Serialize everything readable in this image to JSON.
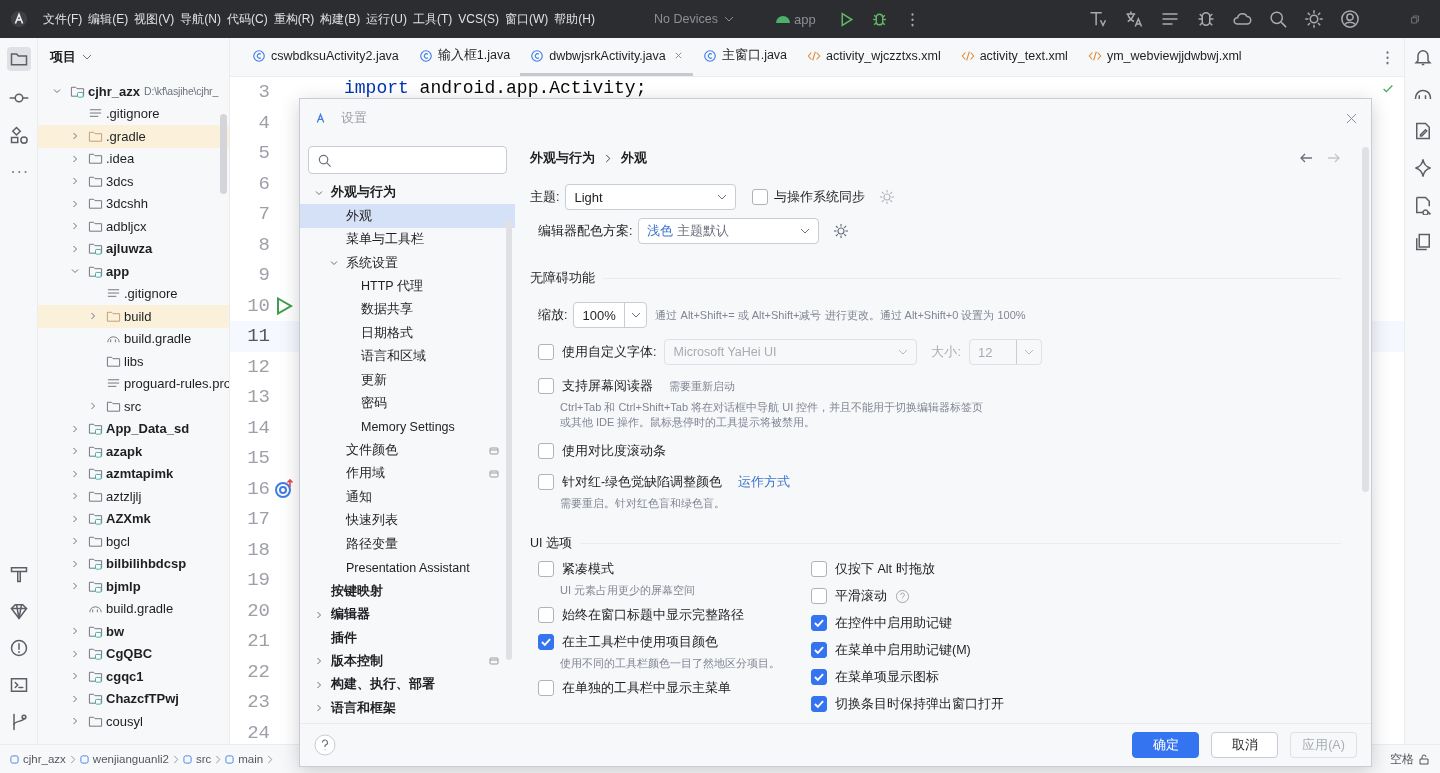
{
  "menu": [
    "文件(F)",
    "编辑(E)",
    "视图(V)",
    "导航(N)",
    "代码(C)",
    "重构(R)",
    "构建(B)",
    "运行(U)",
    "工具(T)",
    "VCS(S)",
    "窗口(W)",
    "帮助(H)"
  ],
  "device": "No Devices",
  "run_config": "app",
  "project_panel": {
    "title": "项目",
    "tree": [
      {
        "name": "cjhr_azx",
        "kind": "module",
        "path": "D:\\kf\\asjihe\\cjhr_",
        "expanded": true,
        "highlighted": false,
        "children": [
          {
            "name": ".gitignore",
            "kind": "file",
            "highlighted": false
          },
          {
            "name": ".gradle",
            "kind": "folder",
            "expanded": false,
            "highlighted": true
          },
          {
            "name": ".idea",
            "kind": "folder",
            "expanded": false,
            "highlighted": false
          },
          {
            "name": "3dcs",
            "kind": "folder",
            "expanded": false,
            "highlighted": false
          },
          {
            "name": "3dcshh",
            "kind": "folder",
            "expanded": false,
            "highlighted": false
          },
          {
            "name": "adbljcx",
            "kind": "folder",
            "expanded": false,
            "highlighted": false
          },
          {
            "name": "ajluwza",
            "kind": "module",
            "expanded": false,
            "highlighted": false
          },
          {
            "name": "app",
            "kind": "module",
            "expanded": true,
            "highlighted": false,
            "children": [
              {
                "name": ".gitignore",
                "kind": "file",
                "highlighted": false
              },
              {
                "name": "build",
                "kind": "folder",
                "expanded": false,
                "highlighted": true
              },
              {
                "name": "build.gradle",
                "kind": "gradle",
                "highlighted": false
              },
              {
                "name": "libs",
                "kind": "folder",
                "highlighted": false
              },
              {
                "name": "proguard-rules.pro",
                "kind": "file",
                "highlighted": false
              },
              {
                "name": "src",
                "kind": "folder",
                "expanded": false,
                "highlighted": false
              }
            ]
          },
          {
            "name": "App_Data_sd",
            "kind": "module",
            "expanded": false,
            "highlighted": false
          },
          {
            "name": "azapk",
            "kind": "module",
            "expanded": false,
            "highlighted": false
          },
          {
            "name": "azmtapimk",
            "kind": "module",
            "expanded": false,
            "highlighted": false
          },
          {
            "name": "aztzljlj",
            "kind": "folder",
            "expanded": false,
            "highlighted": false
          },
          {
            "name": "AZXmk",
            "kind": "module",
            "expanded": false,
            "highlighted": false
          },
          {
            "name": "bgcl",
            "kind": "folder",
            "expanded": false,
            "highlighted": false
          },
          {
            "name": "bilbilihbdcsp",
            "kind": "module",
            "expanded": false,
            "highlighted": false
          },
          {
            "name": "bjmlp",
            "kind": "module",
            "expanded": false,
            "highlighted": false
          },
          {
            "name": "build.gradle",
            "kind": "gradle",
            "highlighted": false
          },
          {
            "name": "bw",
            "kind": "module",
            "expanded": false,
            "highlighted": false
          },
          {
            "name": "CgQBC",
            "kind": "module",
            "expanded": false,
            "highlighted": false
          },
          {
            "name": "cgqc1",
            "kind": "module",
            "expanded": false,
            "highlighted": false
          },
          {
            "name": "ChazcfTPwj",
            "kind": "module",
            "expanded": false,
            "highlighted": false
          },
          {
            "name": "cousyl",
            "kind": "folder",
            "expanded": false,
            "highlighted": false
          }
        ]
      }
    ]
  },
  "editor_tabs": [
    {
      "label": "cswbdksuActivity2.java",
      "kind": "java",
      "selected": false
    },
    {
      "label": "输入框1.java",
      "kind": "java",
      "selected": false
    },
    {
      "label": "dwbwjsrkActivity.java",
      "kind": "java",
      "selected": true
    },
    {
      "label": "主窗口.java",
      "kind": "java",
      "selected": false
    },
    {
      "label": "activity_wjczztxs.xml",
      "kind": "xml",
      "selected": false
    },
    {
      "label": "activity_text.xml",
      "kind": "xml",
      "selected": false
    },
    {
      "label": "ym_webviewjjdwbwj.xml",
      "kind": "xml",
      "selected": false
    }
  ],
  "code_lines": [
    {
      "number": "3",
      "code": "**import** android.app.Activity;",
      "current": false
    },
    {
      "number": "4",
      "current": false
    },
    {
      "number": "5",
      "current": false
    },
    {
      "number": "6",
      "current": false
    },
    {
      "number": "7",
      "current": false
    },
    {
      "number": "8",
      "current": false
    },
    {
      "number": "9",
      "current": false
    },
    {
      "number": "10",
      "current": false,
      "kind": "run"
    },
    {
      "number": "11",
      "current": true
    },
    {
      "number": "12",
      "current": false
    },
    {
      "number": "13",
      "current": false
    },
    {
      "number": "14",
      "current": false
    },
    {
      "number": "15",
      "current": false
    },
    {
      "number": "16",
      "current": false,
      "kind": "override"
    },
    {
      "number": "17",
      "current": false
    },
    {
      "number": "18",
      "current": false
    },
    {
      "number": "19",
      "current": false
    },
    {
      "number": "20",
      "current": false
    },
    {
      "number": "21",
      "current": false
    },
    {
      "number": "22",
      "current": false
    },
    {
      "number": "23",
      "current": false
    },
    {
      "number": "24",
      "current": false
    }
  ],
  "status_bar": {
    "breadcrumbs": [
      "cjhr_azx",
      "wenjianguanli2",
      "src",
      "main"
    ],
    "indent": "空格"
  },
  "settings": {
    "title": "设置",
    "tree": [
      {
        "label": "外观与行为",
        "expanded": true,
        "selected": false,
        "children": [
          {
            "label": "外观",
            "selected": true
          },
          {
            "label": "菜单与工具栏",
            "selected": false
          },
          {
            "label": "系统设置",
            "expanded": true,
            "selected": false,
            "children": [
              {
                "label": "HTTP 代理",
                "selected": false
              },
              {
                "label": "数据共享",
                "selected": false
              },
              {
                "label": "日期格式",
                "selected": false
              },
              {
                "label": "语言和区域",
                "selected": false
              },
              {
                "label": "更新",
                "selected": false
              },
              {
                "label": "密码",
                "selected": false
              },
              {
                "label": "Memory Settings",
                "selected": false
              }
            ]
          },
          {
            "label": "文件颜色",
            "selected": false,
            "project_icon": true
          },
          {
            "label": "作用域",
            "selected": false,
            "project_icon": true
          },
          {
            "label": "通知",
            "selected": false
          },
          {
            "label": "快速列表",
            "selected": false
          },
          {
            "label": "路径变量",
            "selected": false
          },
          {
            "label": "Presentation Assistant",
            "selected": false
          }
        ]
      },
      {
        "label": "按键映射",
        "selected": false
      },
      {
        "label": "编辑器",
        "expanded": false,
        "selected": false
      },
      {
        "label": "插件",
        "selected": false
      },
      {
        "label": "版本控制",
        "expanded": false,
        "selected": false,
        "project_icon": true
      },
      {
        "label": "构建、执行、部署",
        "expanded": false,
        "selected": false
      },
      {
        "label": "语言和框架",
        "expanded": false,
        "selected": false
      }
    ],
    "breadcrumb": [
      "外观与行为",
      "外观"
    ],
    "theme": {
      "label": "主题:",
      "value": "Light",
      "sync": {
        "label": "与操作系统同步",
        "checked": false
      }
    },
    "scheme": {
      "label": "编辑器配色方案:",
      "accent": "浅色",
      "value": "主题默认"
    },
    "accessibility": {
      "title": "无障碍功能",
      "zoom": {
        "label": "缩放:",
        "value": "100%",
        "hint": "通过 Alt+Shift+= 或 Alt+Shift+减号 进行更改。通过 Alt+Shift+0 设置为 100%"
      },
      "options": [
        {
          "kind": "font",
          "label": "使用自定义字体:",
          "checked": false,
          "font": "Microsoft YaHei UI",
          "size_label": "大小:",
          "size": "12"
        },
        {
          "kind": "check",
          "label": "支持屏幕阅读器",
          "checked": false,
          "note": "需要重新启动",
          "description": [
            "Ctrl+Tab 和 Ctrl+Shift+Tab 将在对话框中导航 UI 控件，并且不能用于切换编辑器标签页",
            "或其他 IDE 操作。鼠标悬停时的工具提示将被禁用。"
          ]
        },
        {
          "kind": "check",
          "label": "使用对比度滚动条",
          "checked": false
        },
        {
          "kind": "check",
          "label": "针对红-绿色觉缺陷调整颜色",
          "checked": false,
          "link": "运作方式",
          "description": [
            "需要重启。针对红色盲和绿色盲。"
          ]
        }
      ]
    },
    "ui_options": {
      "title": "UI 选项",
      "left": [
        {
          "label": "紧凑模式",
          "checked": false,
          "description": [
            "UI 元素占用更少的屏幕空间"
          ]
        },
        {
          "label": "始终在窗口标题中显示完整路径",
          "checked": false
        },
        {
          "label": "在主工具栏中使用项目颜色",
          "checked": true,
          "description": [
            "使用不同的工具栏颜色一目了然地区分项目。"
          ]
        },
        {
          "label": "在单独的工具栏中显示主菜单",
          "checked": false
        }
      ],
      "right": [
        {
          "label": "仅按下 Alt 时拖放",
          "checked": false
        },
        {
          "label": "平滑滚动",
          "checked": false,
          "help": true
        },
        {
          "label": "在控件中启用助记键",
          "checked": true
        },
        {
          "label": "在菜单中启用助记键(M)",
          "checked": true
        },
        {
          "label": "在菜单项显示图标",
          "checked": true
        },
        {
          "label": "切换条目时保持弹出窗口打开",
          "checked": true
        }
      ]
    },
    "buttons": [
      {
        "label": "确定",
        "kind": "primary"
      },
      {
        "label": "取消",
        "kind": "normal"
      },
      {
        "label": "应用(A)",
        "kind": "disabled"
      }
    ]
  }
}
